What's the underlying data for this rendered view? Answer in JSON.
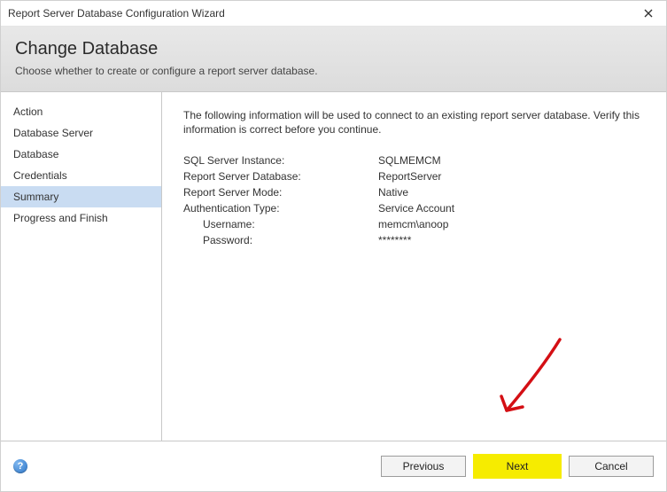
{
  "window": {
    "title": "Report Server Database Configuration Wizard"
  },
  "header": {
    "heading": "Change Database",
    "subheading": "Choose whether to create or configure a report server database."
  },
  "steps": [
    {
      "label": "Action",
      "selected": false
    },
    {
      "label": "Database Server",
      "selected": false
    },
    {
      "label": "Database",
      "selected": false
    },
    {
      "label": "Credentials",
      "selected": false
    },
    {
      "label": "Summary",
      "selected": true
    },
    {
      "label": "Progress and Finish",
      "selected": false
    }
  ],
  "content": {
    "intro": "The following information will be used to connect to an existing report server database. Verify this information is correct before you continue.",
    "rows": [
      {
        "label": "SQL Server Instance:",
        "value": "SQLMEMCM",
        "indent": false
      },
      {
        "label": "Report Server Database:",
        "value": "ReportServer",
        "indent": false
      },
      {
        "label": "Report Server Mode:",
        "value": "Native",
        "indent": false
      },
      {
        "label": "Authentication Type:",
        "value": "Service Account",
        "indent": false
      },
      {
        "label": "Username:",
        "value": "memcm\\anoop",
        "indent": true
      },
      {
        "label": "Password:",
        "value": "********",
        "indent": true
      }
    ]
  },
  "buttons": {
    "previous": "Previous",
    "next": "Next",
    "cancel": "Cancel"
  },
  "annotation": {
    "highlight_button": "next",
    "arrow_color": "#d40f14"
  }
}
